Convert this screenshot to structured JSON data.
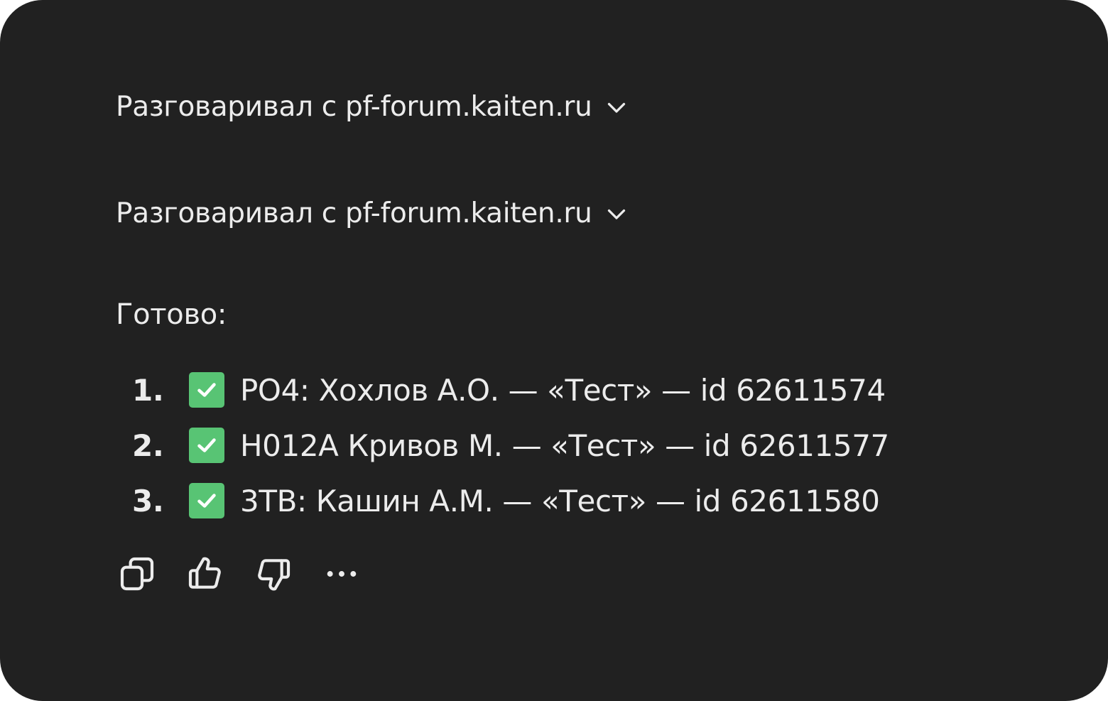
{
  "tool_calls": [
    {
      "label": "Разговаривал с pf-forum.kaiten.ru"
    },
    {
      "label": "Разговаривал с pf-forum.kaiten.ru"
    }
  ],
  "message": {
    "done_label": "Готово:",
    "items": [
      {
        "number": "1.",
        "text": "PO4: Хохлов А.О. — «Тест» — id 62611574"
      },
      {
        "number": "2.",
        "text": "H012A Кривов М. — «Тест» — id 62611577"
      },
      {
        "number": "3.",
        "text": "3ТВ: Кашин А.М. — «Тест» — id 62611580"
      }
    ]
  },
  "colors": {
    "background": "#212121",
    "text": "#ececec",
    "check_green": "#58c474"
  },
  "icons": {
    "check": "check-mark-emoji-icon",
    "copy": "copy-icon",
    "like": "thumbs-up-icon",
    "dislike": "thumbs-down-icon",
    "more": "more-dots-icon",
    "expand": "chevron-down-icon"
  }
}
